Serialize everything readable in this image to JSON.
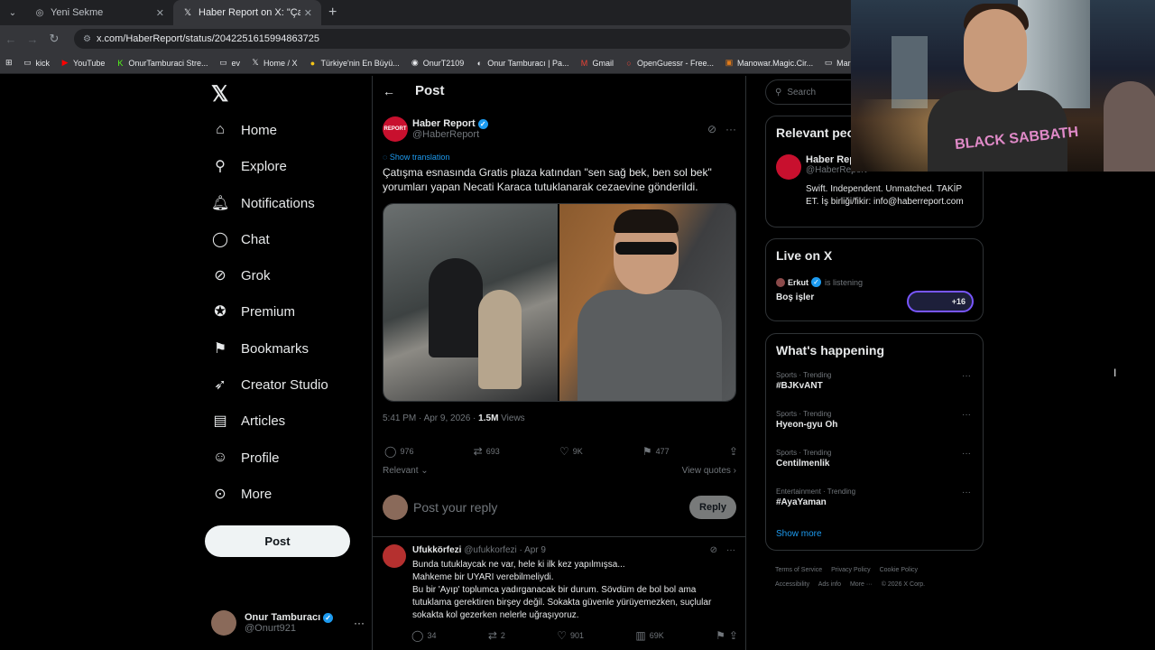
{
  "browser": {
    "tabs": [
      {
        "title": "Yeni Sekme",
        "active": false
      },
      {
        "title": "Haber Report on X: \"Çatışma es",
        "active": true
      }
    ],
    "url": "x.com/HaberReport/status/2042251615994863725",
    "bookmarks": [
      "kick",
      "YouTube",
      "OnurTamburaci Stre...",
      "ev",
      "Home / X",
      "Türkiye'nin En Büyü...",
      "OnurT2109",
      "Onur Tamburacı | Pa...",
      "Gmail",
      "OpenGuessr - Free...",
      "Manowar.Magic.Cir...",
      "Maradona"
    ]
  },
  "nav": {
    "items": [
      "Home",
      "Explore",
      "Notifications",
      "Chat",
      "Grok",
      "Premium",
      "Bookmarks",
      "Creator Studio",
      "Articles",
      "Profile",
      "More"
    ],
    "post_label": "Post",
    "profile_name": "Onur Tamburacı",
    "profile_handle": "@Onurt921"
  },
  "post": {
    "header": "Post",
    "author_name": "Haber Report",
    "author_handle": "@HaberReport",
    "logo_text": "REPORT",
    "show_translation": "Show translation",
    "text": "Çatışma esnasında Gratis plaza katından \"sen sağ bek, ben sol bek\" yorumları yapan Necati Karaca tutuklanarak cezaevine gönderildi.",
    "time": "5:41 PM · Apr 9, 2026 · ",
    "views_count": "1.5M",
    "views_label": " Views",
    "replies": "976",
    "reposts": "693",
    "likes": "9K",
    "bookmarks": "477",
    "relevant": "Relevant",
    "view_quotes": "View quotes",
    "reply_placeholder": "Post your reply",
    "reply_button": "Reply"
  },
  "comment": {
    "name": "Ufukkörfezi",
    "handle": "@ufukkorfezi · Apr 9",
    "text": "Bunda tutuklaycak ne var, hele ki ilk kez yapılmışsa...\nMahkeme bir UYARI verebilmeliydi.\nBu bir 'Ayıp' toplumca yadırganacak bir durum.  Sövdüm de bol bol ama tutuklama gerektiren birşey değil. Sokakta güvenle yürüyemezken, suçlular sokakta kol gezerken nelerle uğraşıyoruz.",
    "replies": "34",
    "reposts": "2",
    "likes": "901",
    "views": "69K"
  },
  "sidebar": {
    "search_placeholder": "Search",
    "relevant_title": "Relevant people",
    "rp_name": "Haber Report",
    "rp_handle": "@HaberReport",
    "rp_bio": "Swift. Independent. Unmatched. TAKİP ET. İş birliği/fikir: info@haberreport.com",
    "live_title": "Live on X",
    "live_user": "Erkut",
    "live_status": "is listening",
    "live_space": "Boş işler",
    "live_count": "+16",
    "happening_title": "What's happening",
    "trends": [
      {
        "category": "Sports · Trending",
        "name": "#BJKvANT"
      },
      {
        "category": "Sports · Trending",
        "name": "Hyeon-gyu Oh"
      },
      {
        "category": "Sports · Trending",
        "name": "Centilmenlik"
      },
      {
        "category": "Entertainment · Trending",
        "name": "#AyaYaman"
      }
    ],
    "show_more": "Show more",
    "footer": [
      "Terms of Service",
      "Privacy Policy",
      "Cookie Policy",
      "Accessibility",
      "Ads info",
      "More ···",
      "© 2026 X Corp."
    ]
  },
  "webcam": {
    "shirt_text": "BLACK SABBATH"
  }
}
